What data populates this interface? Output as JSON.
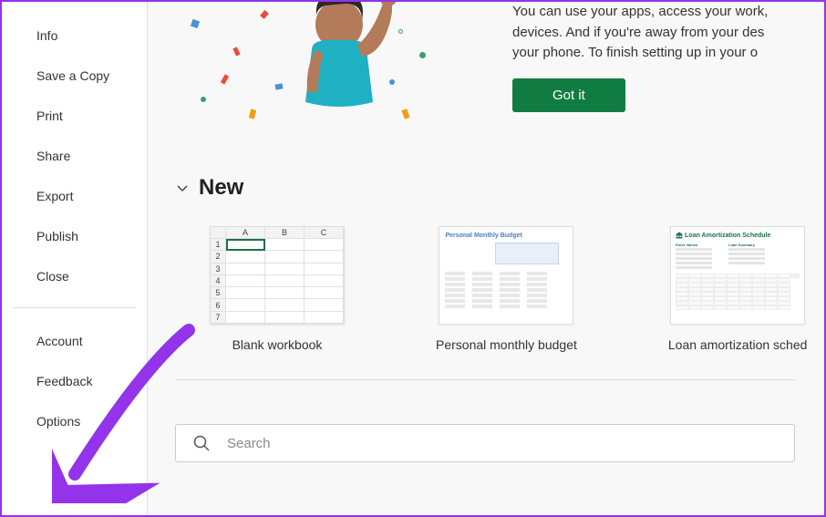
{
  "sidebar": {
    "items": [
      {
        "label": "Info"
      },
      {
        "label": "Save a Copy"
      },
      {
        "label": "Print"
      },
      {
        "label": "Share"
      },
      {
        "label": "Export"
      },
      {
        "label": "Publish"
      },
      {
        "label": "Close"
      }
    ],
    "bottom_items": [
      {
        "label": "Account"
      },
      {
        "label": "Feedback"
      },
      {
        "label": "Options"
      }
    ]
  },
  "banner": {
    "desc_line1": "You can use your apps, access your work,",
    "desc_line2": "devices. And if you're away from your des",
    "desc_line3": "your phone. To finish setting up in your o",
    "button_label": "Got it"
  },
  "new_section": {
    "title": "New",
    "templates": [
      {
        "label": "Blank workbook"
      },
      {
        "label": "Personal monthly budget"
      },
      {
        "label": "Loan amortization sched"
      }
    ]
  },
  "search": {
    "placeholder": "Search"
  },
  "thumb": {
    "blank": {
      "cols": [
        "A",
        "B",
        "C"
      ],
      "rows": [
        "1",
        "2",
        "3",
        "4",
        "5",
        "6",
        "7"
      ]
    },
    "budget": {
      "title": "Personal Monthly Budget"
    },
    "loan": {
      "title": "Loan Amortization Schedule",
      "h1": "Enter Values",
      "h2": "Loan Summary"
    }
  },
  "colors": {
    "accent": "#107c41",
    "annotation": "#9333ea"
  }
}
